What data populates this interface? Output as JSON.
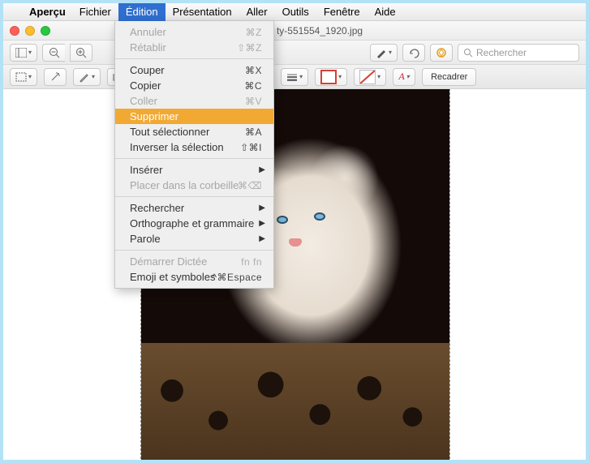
{
  "menubar": {
    "app": "Aperçu",
    "items": [
      "Fichier",
      "Édition",
      "Présentation",
      "Aller",
      "Outils",
      "Fenêtre",
      "Aide"
    ],
    "active_index": 1
  },
  "window": {
    "title": "ty-551554_1920.jpg",
    "search_placeholder": "Rechercher"
  },
  "toolbar2": {
    "fill_color": "#d64034",
    "crop_label": "Recadrer"
  },
  "dropdown": {
    "items": [
      {
        "label": "Annuler",
        "shortcut": "⌘Z",
        "disabled": true
      },
      {
        "label": "Rétablir",
        "shortcut": "⇧⌘Z",
        "disabled": true
      },
      {
        "sep": true
      },
      {
        "label": "Couper",
        "shortcut": "⌘X"
      },
      {
        "label": "Copier",
        "shortcut": "⌘C"
      },
      {
        "label": "Coller",
        "shortcut": "⌘V",
        "disabled": true
      },
      {
        "label": "Supprimer",
        "highlight": true
      },
      {
        "label": "Tout sélectionner",
        "shortcut": "⌘A"
      },
      {
        "label": "Inverser la sélection",
        "shortcut": "⇧⌘I"
      },
      {
        "sep": true
      },
      {
        "label": "Insérer",
        "submenu": true
      },
      {
        "label": "Placer dans la corbeille",
        "shortcut": "⌘⌫",
        "disabled": true
      },
      {
        "sep": true
      },
      {
        "label": "Rechercher",
        "submenu": true
      },
      {
        "label": "Orthographe et grammaire",
        "submenu": true
      },
      {
        "label": "Parole",
        "submenu": true
      },
      {
        "sep": true
      },
      {
        "label": "Démarrer Dictée",
        "shortcut": "fn fn",
        "disabled": true
      },
      {
        "label": "Emoji et symboles",
        "shortcut": "^⌘Espace"
      }
    ]
  }
}
